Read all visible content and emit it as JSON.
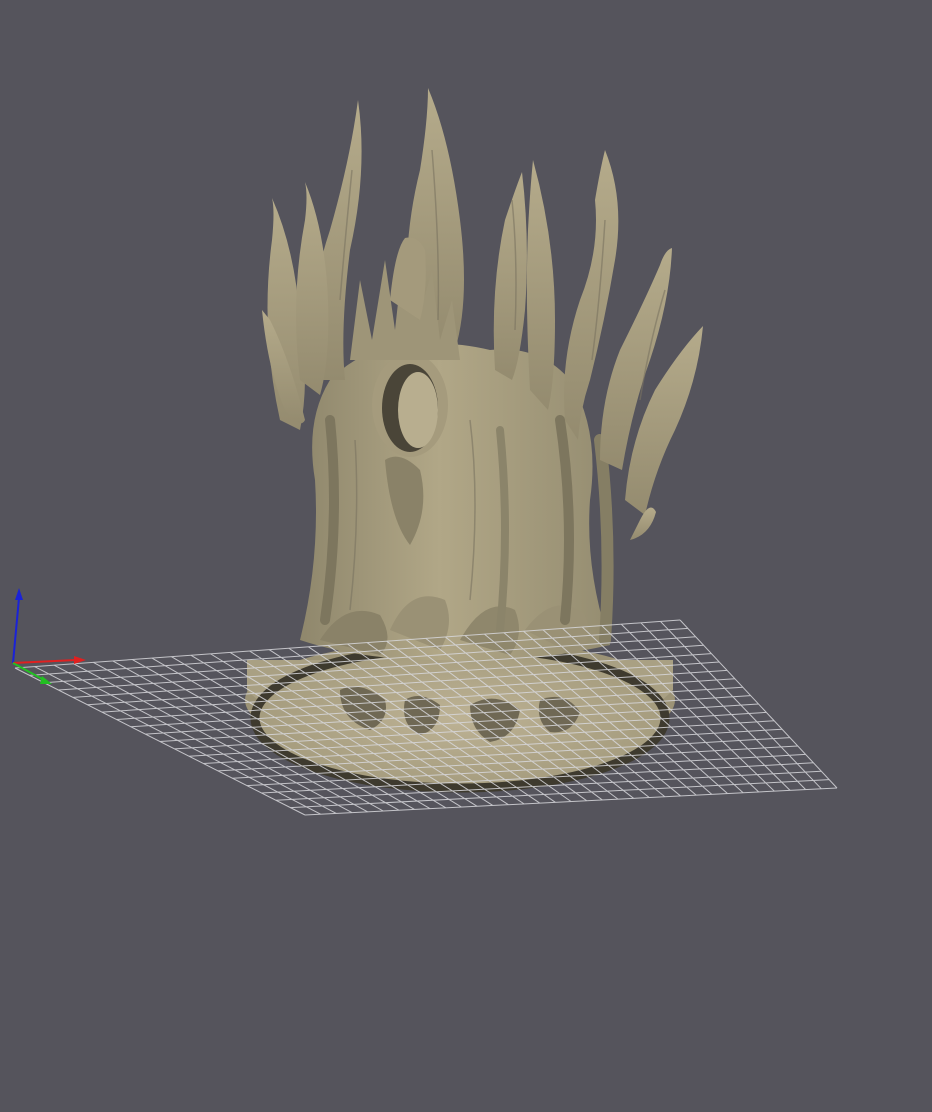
{
  "viewport": {
    "background": "#55545c",
    "model_color": "#a59b7d",
    "model_shadow": "#6e6752",
    "grid_color": "#d8d8dc"
  },
  "axes_gizmo": {
    "x_axis_color": "#e02020",
    "y_axis_color": "#22c022",
    "z_axis_color": "#1a22d8",
    "icon": "xyz-axes-icon"
  },
  "model": {
    "icon": "flame-throne-mesh"
  },
  "build_plate": {
    "icon": "grid-plane"
  }
}
